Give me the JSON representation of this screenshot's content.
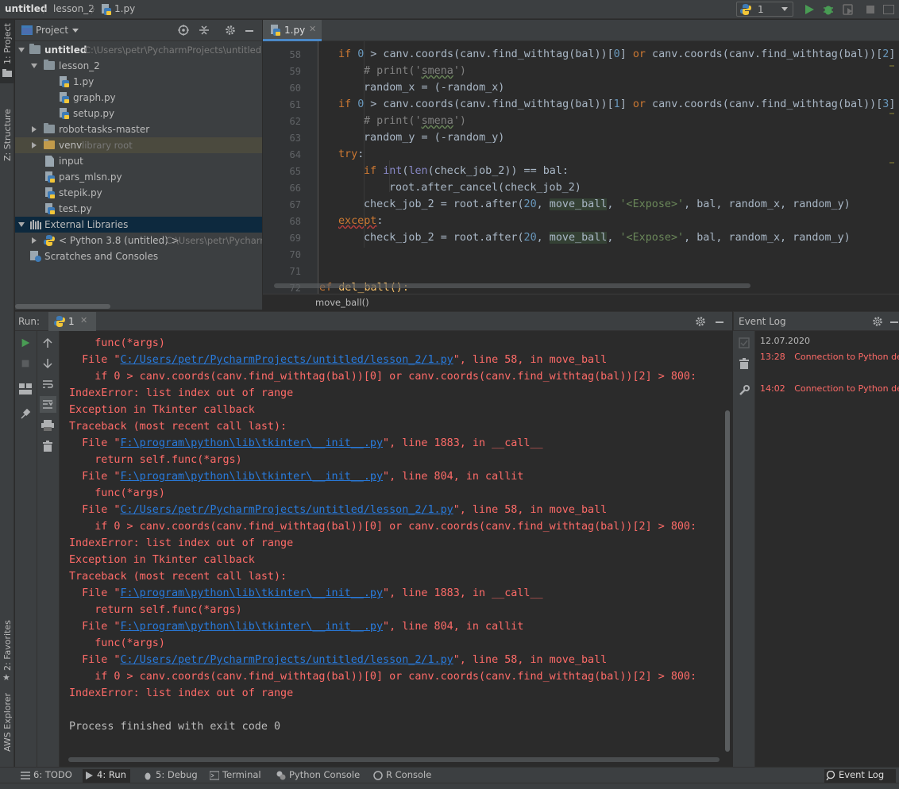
{
  "navbar": {
    "project": "untitled",
    "folder": "lesson_2",
    "file": "1.py",
    "run_config": "1"
  },
  "left_stripe": {
    "project_tab": "1: Project",
    "structure_tab": "Z: Structure",
    "favorites_tab": "2: Favorites",
    "aws_tab": "AWS Explorer"
  },
  "project_panel": {
    "title": "Project",
    "tree": {
      "root_name": "untitled",
      "root_path": "C:\\Users\\petr\\PycharmProjects\\untitled",
      "lesson_folder": "lesson_2",
      "lesson_files": [
        "1.py",
        "graph.py",
        "setup.py"
      ],
      "robot_folder": "robot-tasks-master",
      "venv_folder": "venv",
      "venv_hint": "library root",
      "root_files": [
        "input",
        "pars_mlsn.py",
        "stepik.py",
        "test.py"
      ],
      "external_libraries": "External Libraries",
      "python_sdk": "< Python 3.8 (untitled) >",
      "python_sdk_path": "C:\\Users\\petr\\Pycharm",
      "scratches": "Scratches and Consoles"
    }
  },
  "editor": {
    "tab": "1.py",
    "breadcrumb": "move_ball()",
    "line_numbers": [
      "58",
      "59",
      "60",
      "61",
      "62",
      "63",
      "64",
      "65",
      "66",
      "67",
      "68",
      "69",
      "70",
      "71",
      "72"
    ],
    "lines": {
      "l58": [
        "if ",
        "0",
        " > canv.coords(canv.find_withtag(bal))[",
        "0",
        "] ",
        "or",
        " canv.coords(canv.find_withtag(bal))[",
        "2",
        "] >"
      ],
      "l59": [
        "# print('",
        "smena",
        "')"
      ],
      "l60": "random_x = (-random_x)",
      "l61": [
        "if ",
        "0",
        " > canv.coords(canv.find_withtag(bal))[",
        "1",
        "] ",
        "or",
        " canv.coords(canv.find_withtag(bal))[",
        "3",
        "] >"
      ],
      "l62": [
        "# print('",
        "smena",
        "')"
      ],
      "l63": "random_y = (-random_y)",
      "l64": [
        "try",
        ":"
      ],
      "l65": [
        "if ",
        "int",
        "(",
        "len",
        "(check_job_2)) == bal:"
      ],
      "l66": "root.after_cancel(check_job_2)",
      "l67": [
        "check_job_2 = root.after(",
        "20",
        ", ",
        "move_ball",
        ", ",
        "'<Expose>'",
        ", bal, random_x, random_y)"
      ],
      "l68": [
        "except",
        ":"
      ],
      "l69": [
        "check_job_2 = root.after(",
        "20",
        ", ",
        "move_ball",
        ", ",
        "'<Expose>'",
        ", bal, random_x, random_y)"
      ],
      "l72": [
        "def ",
        "del_ball():"
      ]
    }
  },
  "run_window": {
    "label": "Run:",
    "config_tab": "1",
    "console": [
      {
        "type": "plain_red",
        "text": "    func(*args)"
      },
      {
        "type": "file",
        "pre": "  File \"",
        "link": "C:/Users/petr/PycharmProjects/untitled/lesson_2/1.py",
        "post": "\", line 58, in move_ball"
      },
      {
        "type": "plain_red",
        "text": "    if 0 > canv.coords(canv.find_withtag(bal))[0] or canv.coords(canv.find_withtag(bal))[2] > 800:"
      },
      {
        "type": "plain_red",
        "text": "IndexError: list index out of range"
      },
      {
        "type": "plain_red",
        "text": "Exception in Tkinter callback"
      },
      {
        "type": "plain_red",
        "text": "Traceback (most recent call last):"
      },
      {
        "type": "file",
        "pre": "  File \"",
        "link": "F:\\program\\python\\lib\\tkinter\\__init__.py",
        "post": "\", line 1883, in __call__"
      },
      {
        "type": "plain_red",
        "text": "    return self.func(*args)"
      },
      {
        "type": "file",
        "pre": "  File \"",
        "link": "F:\\program\\python\\lib\\tkinter\\__init__.py",
        "post": "\", line 804, in callit"
      },
      {
        "type": "plain_red",
        "text": "    func(*args)"
      },
      {
        "type": "file",
        "pre": "  File \"",
        "link": "C:/Users/petr/PycharmProjects/untitled/lesson_2/1.py",
        "post": "\", line 58, in move_ball"
      },
      {
        "type": "plain_red",
        "text": "    if 0 > canv.coords(canv.find_withtag(bal))[0] or canv.coords(canv.find_withtag(bal))[2] > 800:"
      },
      {
        "type": "plain_red",
        "text": "IndexError: list index out of range"
      },
      {
        "type": "plain_red",
        "text": "Exception in Tkinter callback"
      },
      {
        "type": "plain_red",
        "text": "Traceback (most recent call last):"
      },
      {
        "type": "file",
        "pre": "  File \"",
        "link": "F:\\program\\python\\lib\\tkinter\\__init__.py",
        "post": "\", line 1883, in __call__"
      },
      {
        "type": "plain_red",
        "text": "    return self.func(*args)"
      },
      {
        "type": "file",
        "pre": "  File \"",
        "link": "F:\\program\\python\\lib\\tkinter\\__init__.py",
        "post": "\", line 804, in callit"
      },
      {
        "type": "plain_red",
        "text": "    func(*args)"
      },
      {
        "type": "file",
        "pre": "  File \"",
        "link": "C:/Users/petr/PycharmProjects/untitled/lesson_2/1.py",
        "post": "\", line 58, in move_ball"
      },
      {
        "type": "plain_red",
        "text": "    if 0 > canv.coords(canv.find_withtag(bal))[0] or canv.coords(canv.find_withtag(bal))[2] > 800:"
      },
      {
        "type": "plain_red",
        "text": "IndexError: list index out of range"
      },
      {
        "type": "blank",
        "text": ""
      },
      {
        "type": "plain",
        "text": "Process finished with exit code 0"
      }
    ]
  },
  "event_log": {
    "title": "Event Log",
    "date": "12.07.2020",
    "entries": [
      {
        "time": "13:28",
        "message": "Connection to Python deb"
      },
      {
        "time": "14:02",
        "message": "Connection to Python deb"
      }
    ]
  },
  "bottom_tabs": {
    "todo": "6: TODO",
    "run": "4: Run",
    "debug": "5: Debug",
    "terminal": "Terminal",
    "python_console": "Python Console",
    "r_console": "R Console",
    "event_log": "Event Log"
  },
  "colors": {
    "background": "#2b2b2b",
    "panel": "#3c3f41",
    "error_text": "#ff6b68",
    "link": "#287bde",
    "keyword": "#cc7832",
    "number": "#6897bb",
    "string": "#6a8759",
    "run_green": "#499c54"
  },
  "icons": [
    "python-file-icon",
    "folder-icon",
    "run-icon",
    "debug-icon",
    "stop-icon",
    "settings-gear-icon",
    "minimize-icon",
    "target-icon",
    "collapse-all-icon"
  ]
}
